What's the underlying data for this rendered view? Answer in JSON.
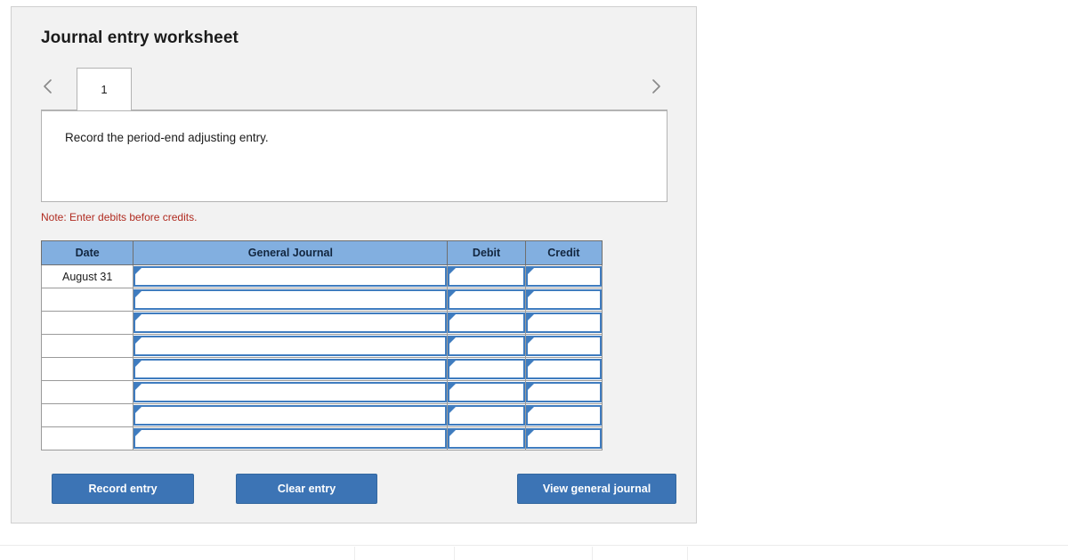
{
  "card": {
    "title": "Journal entry worksheet"
  },
  "tabs": {
    "prev_icon": "chevron-left-icon",
    "next_icon": "chevron-right-icon",
    "items": [
      {
        "label": "1",
        "active": true
      }
    ]
  },
  "instruction": {
    "text": "Record the period-end adjusting entry."
  },
  "note": {
    "text": "Note: Enter debits before credits."
  },
  "table": {
    "columns": [
      "Date",
      "General Journal",
      "Debit",
      "Credit"
    ],
    "rows": [
      {
        "date": "August 31",
        "journal": "",
        "debit": "",
        "credit": ""
      },
      {
        "date": "",
        "journal": "",
        "debit": "",
        "credit": ""
      },
      {
        "date": "",
        "journal": "",
        "debit": "",
        "credit": ""
      },
      {
        "date": "",
        "journal": "",
        "debit": "",
        "credit": ""
      },
      {
        "date": "",
        "journal": "",
        "debit": "",
        "credit": ""
      },
      {
        "date": "",
        "journal": "",
        "debit": "",
        "credit": ""
      },
      {
        "date": "",
        "journal": "",
        "debit": "",
        "credit": ""
      },
      {
        "date": "",
        "journal": "",
        "debit": "",
        "credit": ""
      }
    ]
  },
  "buttons": {
    "record_entry": "Record entry",
    "clear_entry": "Clear entry",
    "view_general_journal": "View general journal"
  },
  "colors": {
    "card_background": "#f2f2f2",
    "card_border": "#cfcfcf",
    "table_header_blue": "#82AFE0",
    "input_border_blue": "#3f7cbf",
    "button_blue": "#3c74b5",
    "note_red": "#b02b20"
  },
  "bottom_chrome": {
    "tick_positions": [
      398,
      510,
      665,
      772
    ]
  }
}
